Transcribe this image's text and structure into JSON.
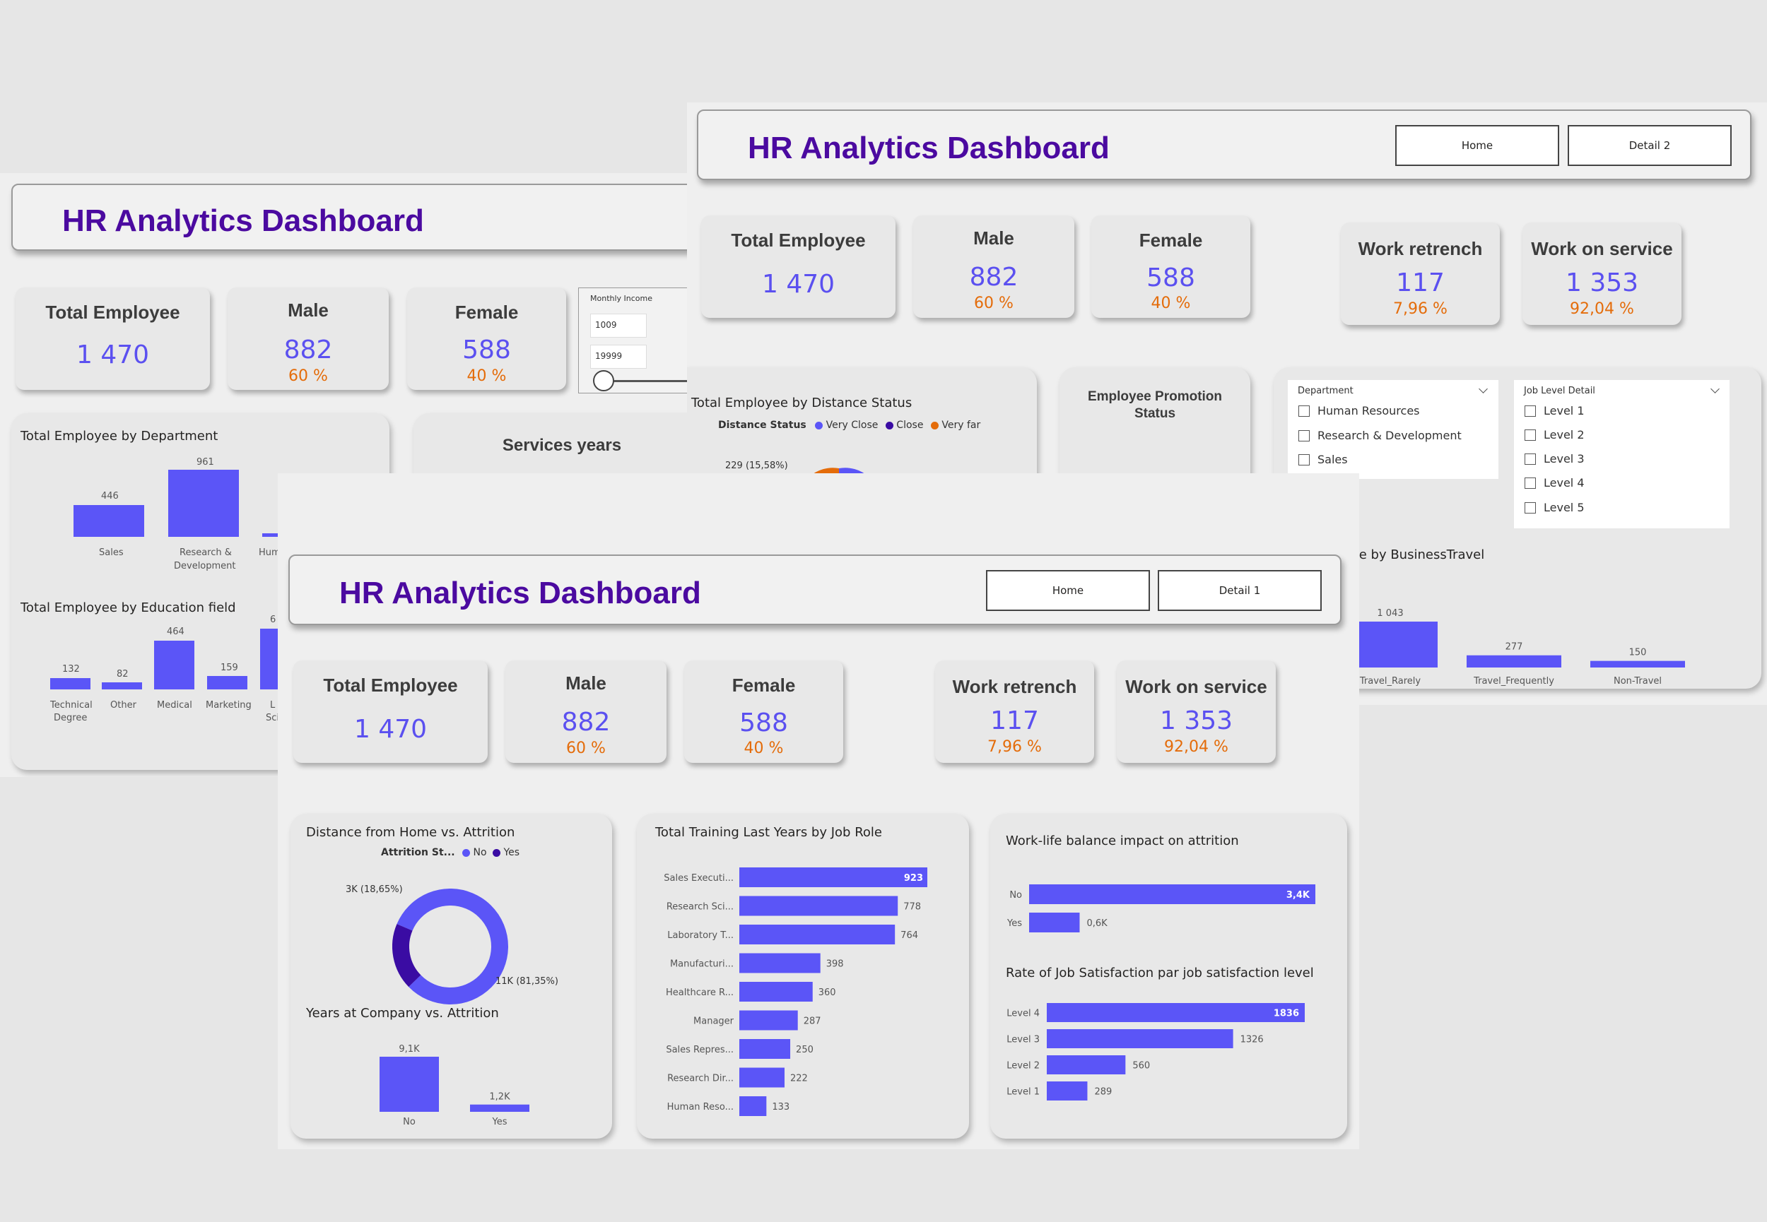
{
  "dashboard_title": "HR Analytics Dashboard",
  "kpis": {
    "total_employee_label": "Total Employee",
    "total_employee_value": "1 470",
    "male_label": "Male",
    "male_value": "882",
    "male_pct": "60 %",
    "female_label": "Female",
    "female_value": "588",
    "female_pct": "40 %",
    "retrench_label": "Work retrench",
    "retrench_value": "117",
    "retrench_pct": "7,96 %",
    "service_label": "Work on service",
    "service_value": "1 353",
    "service_pct": "92,04 %"
  },
  "colors": {
    "accent": "#5b55f7",
    "dark_series": "#3a0ca3",
    "orange": "#e46c0a",
    "title": "#4b0aa0"
  },
  "overview": {
    "income_slicer": {
      "label": "Monthly Income",
      "min": "1009",
      "max": "19999"
    },
    "dept_chart": {
      "title": "Total Employee by Department",
      "categories": [
        "Sales",
        "Research &",
        "Development",
        "Hum"
      ],
      "values": [
        "446",
        "961"
      ]
    },
    "edu_chart": {
      "title": "Total Employee by Education field",
      "categories": [
        "Technical",
        "Degree",
        "Other",
        "Medical",
        "Marketing",
        "L",
        "Scie"
      ],
      "values": [
        "132",
        "82",
        "464",
        "159",
        "6"
      ]
    },
    "services_title": "Services years"
  },
  "detail1": {
    "home_button": "Home",
    "nav_button": "Detail 2",
    "distance_title": "Total Employee by Distance Status",
    "distance_legend_title": "Distance Status",
    "distance_legend": [
      "Very Close",
      "Close",
      "Very far"
    ],
    "distance_label": "229 (15,58%)",
    "promotion_title": "Employee Promotion Status",
    "department_slicer": {
      "title": "Department",
      "options": [
        "Human Resources",
        "Research & Development",
        "Sales"
      ]
    },
    "joblevel_slicer": {
      "title": "Job Level Detail",
      "options": [
        "Level 1",
        "Level 2",
        "Level 3",
        "Level 4",
        "Level 5"
      ]
    },
    "travel_title": "oyee by BusinessTravel"
  },
  "detail2": {
    "home_button": "Home",
    "nav_button": "Detail 1",
    "distance_attr_title": "Distance from Home vs. Attrition",
    "attrition_legend_title": "Attrition St...",
    "attrition_legend": [
      "No",
      "Yes"
    ],
    "donut_labels": [
      "3K (18,65%)",
      "11K (81,35%)"
    ],
    "years_title": "Years at Company vs. Attrition",
    "training_title": "Total Training Last Years by Job Role",
    "worklife_title": "Work-life balance impact on attrition",
    "satisfaction_title": "Rate of Job Satisfaction par job satisfaction level"
  },
  "chart_data": [
    {
      "type": "bar",
      "title": "Total Employee by BusinessTravel",
      "categories": [
        "Travel_Rarely",
        "Travel_Frequently",
        "Non-Travel"
      ],
      "values": [
        1043,
        277,
        150
      ],
      "value_labels": [
        "1 043",
        "277",
        "150"
      ]
    },
    {
      "type": "pie",
      "title": "Distance from Home vs. Attrition",
      "categories": [
        "No",
        "Yes"
      ],
      "values": [
        81.35,
        18.65
      ]
    },
    {
      "type": "bar",
      "title": "Years at Company vs. Attrition",
      "categories": [
        "No",
        "Yes"
      ],
      "values": [
        9100,
        1200
      ],
      "value_labels": [
        "9,1K",
        "1,2K"
      ]
    },
    {
      "type": "bar",
      "title": "Total Training Last Years by Job Role",
      "categories": [
        "Sales Executi...",
        "Research Sci...",
        "Laboratory T...",
        "Manufacturi...",
        "Healthcare R...",
        "Manager",
        "Sales Repres...",
        "Research Dir...",
        "Human Reso..."
      ],
      "values": [
        923,
        778,
        764,
        398,
        360,
        287,
        250,
        222,
        133
      ]
    },
    {
      "type": "bar",
      "title": "Work-life balance impact on attrition",
      "categories": [
        "No",
        "Yes"
      ],
      "values": [
        3400,
        600
      ],
      "value_labels": [
        "3,4K",
        "0,6K"
      ]
    },
    {
      "type": "bar",
      "title": "Rate of Job Satisfaction par job satisfaction level",
      "categories": [
        "Level 4",
        "Level 3",
        "Level 2",
        "Level 1"
      ],
      "values": [
        1836,
        1326,
        560,
        289
      ]
    }
  ]
}
